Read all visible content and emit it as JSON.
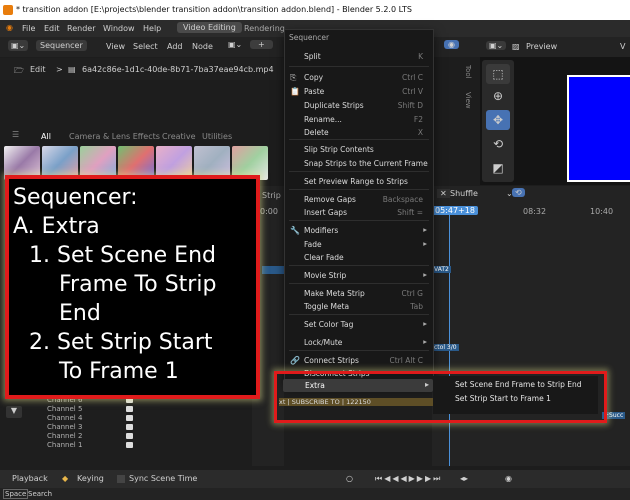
{
  "window": {
    "title": "* transition addon [E:\\projects\\blender transition addon\\transition addon.blend] - Blender 5.2.0 LTS"
  },
  "menubar": {
    "items": [
      "File",
      "Edit",
      "Render",
      "Window",
      "Help"
    ],
    "workspace_tabs": [
      "Video Editing",
      "Rendering"
    ],
    "active_workspace": "Video Editing"
  },
  "seq_header": {
    "editor": "Sequencer",
    "menus": [
      "View",
      "Select",
      "Add",
      "Node"
    ],
    "plus": "+"
  },
  "filebrowser": {
    "edit": "Edit",
    "path_sep": ">",
    "filename": "6a42c86e-1d1c-40de-8b71-7ba37eae94cb.mp4"
  },
  "filter_tabs": [
    "All",
    "Camera & Lens Effects",
    "Creative",
    "Utilities"
  ],
  "annotation": {
    "lines": [
      "Sequencer:",
      "A. Extra",
      "1. Set Scene End",
      "Frame To Strip",
      "End",
      "2. Set Strip Start",
      "To Frame 1"
    ]
  },
  "context_menu": {
    "title": "Sequencer",
    "items": [
      {
        "label": "Split",
        "shortcut": "K",
        "icon": ""
      },
      {
        "label": "Copy",
        "shortcut": "Ctrl C",
        "icon": "⎘"
      },
      {
        "label": "Paste",
        "shortcut": "Ctrl V",
        "icon": "📋"
      },
      {
        "label": "Duplicate Strips",
        "shortcut": "Shift D",
        "icon": ""
      },
      {
        "label": "Rename...",
        "shortcut": "F2",
        "icon": ""
      },
      {
        "label": "Delete",
        "shortcut": "X",
        "icon": ""
      },
      {
        "label": "Slip Strip Contents",
        "shortcut": "",
        "icon": ""
      },
      {
        "label": "Snap Strips to the Current Frame",
        "shortcut": "",
        "icon": ""
      },
      {
        "label": "Set Preview Range to Strips",
        "shortcut": "",
        "icon": ""
      },
      {
        "label": "Remove Gaps",
        "shortcut": "Backspace",
        "icon": ""
      },
      {
        "label": "Insert Gaps",
        "shortcut": "Shift =",
        "icon": ""
      },
      {
        "label": "Modifiers",
        "shortcut": "",
        "icon": "🔧",
        "submenu": true
      },
      {
        "label": "Fade",
        "shortcut": "",
        "icon": "",
        "submenu": true
      },
      {
        "label": "Clear Fade",
        "shortcut": "",
        "icon": ""
      },
      {
        "label": "Movie Strip",
        "shortcut": "",
        "icon": "",
        "submenu": true
      },
      {
        "label": "Make Meta Strip",
        "shortcut": "Ctrl G",
        "icon": ""
      },
      {
        "label": "Toggle Meta",
        "shortcut": "Tab",
        "icon": ""
      },
      {
        "label": "Set Color Tag",
        "shortcut": "",
        "icon": "",
        "submenu": true
      },
      {
        "label": "Lock/Mute",
        "shortcut": "",
        "icon": "",
        "submenu": true
      },
      {
        "label": "Connect Strips",
        "shortcut": "Ctrl Alt C",
        "icon": "🔗"
      },
      {
        "label": "Disconnect Strips",
        "shortcut": "",
        "icon": ""
      },
      {
        "label": "Extra",
        "shortcut": "",
        "icon": "",
        "submenu": true
      }
    ]
  },
  "submenu": {
    "items": [
      "Set Scene End Frame to Strip End",
      "Set Strip Start to Frame 1"
    ]
  },
  "timeline": {
    "shuffle": "Shuffle",
    "current_frame": "05:47+18",
    "ticks": [
      "08:32",
      "10:40"
    ],
    "strip_text": "xt | SUBSCRIBE TO | 122150",
    "frag1": "VAT2",
    "frag2": "ctol 3/0",
    "frag3": "+Succ",
    "left_ticks": [
      "0:00",
      "Strip"
    ]
  },
  "preview": {
    "label": "Preview"
  },
  "channels": [
    "Channel 6",
    "Channel 5",
    "Channel 4",
    "Channel 3",
    "Channel 2",
    "Channel 1"
  ],
  "bottombar": {
    "playback": "Playback",
    "keying": "Keying",
    "sync": "Sync Scene Time"
  },
  "statusbar": {
    "space": "Space",
    "search": "Search"
  },
  "colors": {
    "accent_blue": "#4772b3",
    "annotation_border": "#e01b1b",
    "playhead": "#4a90d9"
  }
}
